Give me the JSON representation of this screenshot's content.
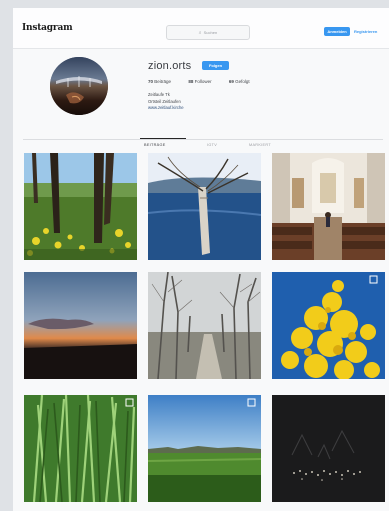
{
  "header": {
    "logo": "Instagram",
    "search_placeholder": "Suchen",
    "login_label": "Anmelden",
    "signup_label": "Registrieren"
  },
  "profile": {
    "username": "zion.orts",
    "follow_label": "Folgen",
    "stats": {
      "posts": "70",
      "posts_label": "Beiträge",
      "followers": "88",
      "followers_label": "Follower",
      "following": "69",
      "following_label": "Gefolgt"
    },
    "bio": {
      "name": "Zeitlaufe Tk",
      "line2": "Ortsteil Zeitlaufen",
      "link": "www.zeitlauf.kirche"
    }
  },
  "tabs": {
    "posts": "Beiträge",
    "igtv": "IGTV",
    "tagged": "Markiert"
  },
  "grid": {
    "rows": [
      [
        "meadow-trees-yellow-flowers",
        "lake-fallen-tree",
        "church-interior"
      ],
      [
        "sunset-horizon",
        "misty-forest-path",
        "yellow-blossom-sky"
      ],
      [
        "green-grass-closeup",
        "green-field-blue-sky",
        "dark-lights-text"
      ]
    ]
  },
  "colors": {
    "accent": "#3897f0",
    "background": "#f8f9fa",
    "text": "#262626"
  }
}
